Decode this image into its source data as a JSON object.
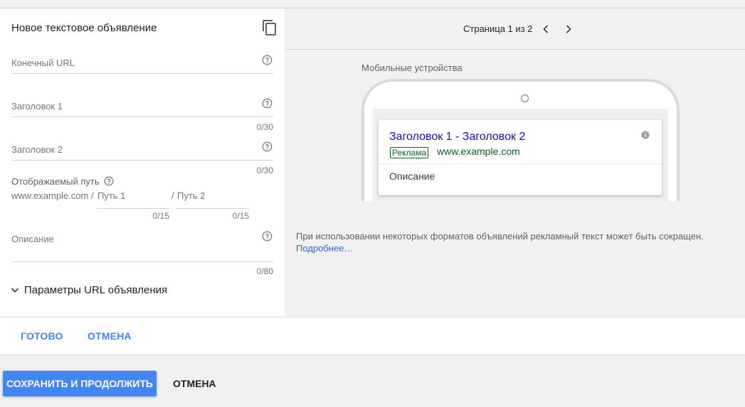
{
  "form": {
    "title": "Новое текстовое объявление",
    "final_url": {
      "label": "Конечный URL"
    },
    "headline1": {
      "label": "Заголовок 1",
      "counter": "0/30"
    },
    "headline2": {
      "label": "Заголовок 2",
      "counter": "0/30"
    },
    "display_path": {
      "label": "Отображаемый путь",
      "base": "www.example.com /",
      "path1_placeholder": "Путь 1",
      "separator": "/",
      "path2_placeholder": "Путь 2",
      "path1_counter": "0/15",
      "path2_counter": "0/15"
    },
    "description": {
      "label": "Описание",
      "counter": "0/80"
    },
    "url_params": "Параметры URL объявления"
  },
  "preview": {
    "pager_text": "Страница 1 из 2",
    "device_label": "Мобильные устройства",
    "ad": {
      "headline": "Заголовок 1 - Заголовок 2",
      "badge": "Реклама",
      "display_url": "www.example.com",
      "description": "Описание"
    },
    "notice": "При использовании некоторых форматов объявлений рекламный текст может быть сокращен.",
    "notice_link": "Подробнее…"
  },
  "card_actions": {
    "done": "ГОТОВО",
    "cancel": "ОТМЕНА"
  },
  "page_actions": {
    "save": "СОХРАНИТЬ И ПРОДОЛЖИТЬ",
    "cancel": "ОТМЕНА"
  },
  "icons": {
    "copy": "copy-icon",
    "help": "help-circle-icon",
    "chevron_left": "chevron-left-icon",
    "chevron_right": "chevron-right-icon",
    "chevron_down": "chevron-down-icon",
    "info": "info-icon"
  },
  "colors": {
    "primary": "#4285f4",
    "ad_headline": "#1a0dab",
    "ad_url": "#006621",
    "link": "#3367d6",
    "panel_bg": "#f1f1f1"
  }
}
